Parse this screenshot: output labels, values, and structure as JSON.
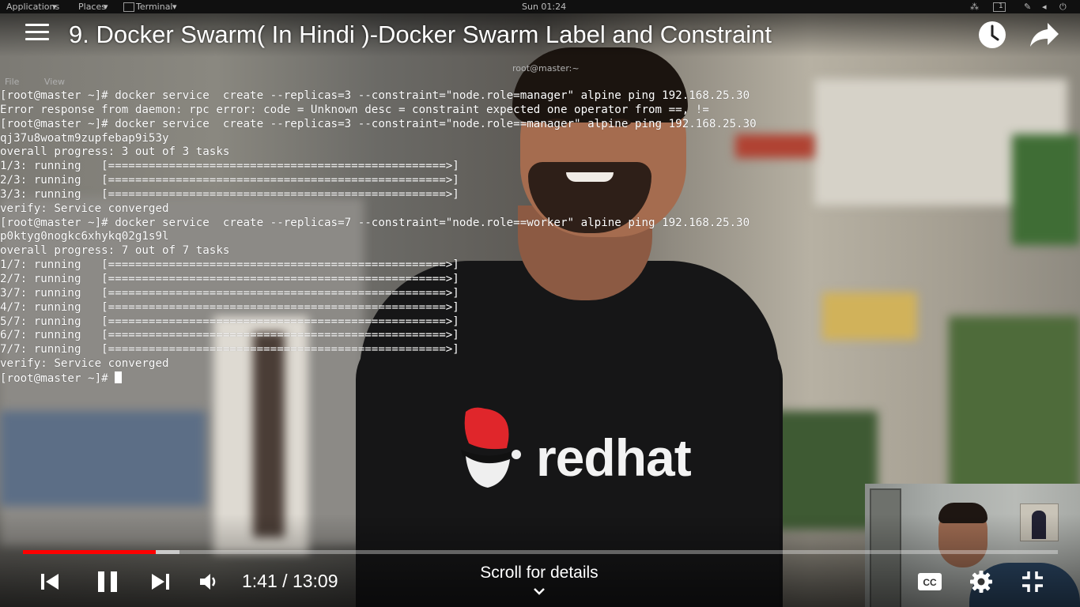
{
  "desktop": {
    "menu_applications": "Applications",
    "menu_places": "Places",
    "menu_terminal": "Terminal",
    "clock": "Sun 01:24",
    "workspace": "1"
  },
  "terminal": {
    "title": "root@master:~",
    "menu": [
      "File",
      "View"
    ],
    "lines": [
      "[root@master ~]# docker service  create --replicas=3 --constraint=\"node.role=manager\" alpine ping 192.168.25.30",
      "Error response from daemon: rpc error: code = Unknown desc = constraint expected one operator from ==, !=",
      "[root@master ~]# docker service  create --replicas=3 --constraint=\"node.role==manager\" alpine ping 192.168.25.30",
      "qj37u8woatm9zupfebap9i53y",
      "overall progress: 3 out of 3 tasks",
      "1/3: running   [==================================================>]",
      "2/3: running   [==================================================>]",
      "3/3: running   [==================================================>]",
      "verify: Service converged",
      "[root@master ~]# docker service  create --replicas=7 --constraint=\"node.role==worker\" alpine ping 192.168.25.30",
      "p0ktyg0nogkc6xhykq02g1s9l",
      "overall progress: 7 out of 7 tasks",
      "1/7: running   [==================================================>]",
      "2/7: running   [==================================================>]",
      "3/7: running   [==================================================>]",
      "4/7: running   [==================================================>]",
      "5/7: running   [==================================================>]",
      "6/7: running   [==================================================>]",
      "7/7: running   [==================================================>]",
      "verify: Service converged",
      "[root@master ~]# "
    ]
  },
  "player": {
    "title": "9. Docker Swarm( In Hindi )-Docker Swarm Label and Constraint",
    "current_time": "1:41",
    "separator": " / ",
    "duration": "13:09",
    "progress_fraction": 0.128,
    "buffered_fraction": 0.151,
    "scroll_hint": "Scroll for details",
    "shirt_logo": "redhat",
    "colors": {
      "played": "#ff0000",
      "logo_red": "#e0262b"
    },
    "icons": [
      "menu-icon",
      "watch-later-icon",
      "share-icon",
      "previous-icon",
      "pause-icon",
      "next-icon",
      "volume-icon",
      "captions-icon",
      "settings-icon",
      "exit-fullscreen-icon",
      "chevron-down-icon"
    ]
  }
}
